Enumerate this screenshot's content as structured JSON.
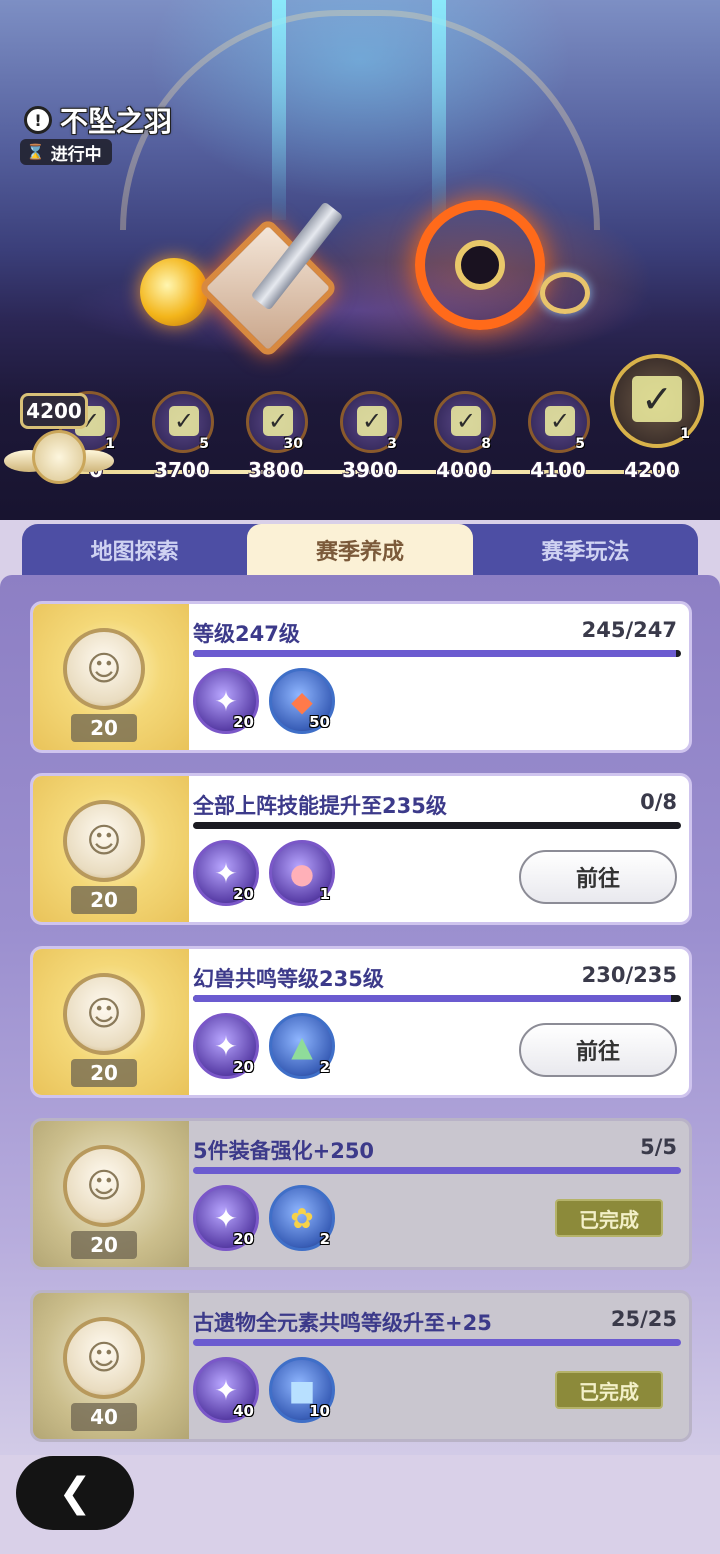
{
  "event": {
    "title": "不坠之羽",
    "status": "进行中",
    "current_points": "4200"
  },
  "milestones": [
    {
      "label": "0",
      "count": "1"
    },
    {
      "label": "3700",
      "count": "5"
    },
    {
      "label": "3800",
      "count": "30"
    },
    {
      "label": "3900",
      "count": "3"
    },
    {
      "label": "4000",
      "count": "8"
    },
    {
      "label": "4100",
      "count": "5"
    },
    {
      "label": "4200",
      "count": "1"
    }
  ],
  "tabs": [
    {
      "label": "地图探索"
    },
    {
      "label": "赛季养成"
    },
    {
      "label": "赛季玩法"
    }
  ],
  "active_tab": "赛季养成",
  "tasks": [
    {
      "title": "等级247级",
      "progress": "245/247",
      "progress_fraction": 0.99,
      "reward": "20",
      "items": [
        {
          "icon": "purple-orb-icon",
          "count": "20"
        },
        {
          "icon": "red-crystal-icon",
          "count": "50"
        }
      ],
      "action": "",
      "done": false
    },
    {
      "title": "全部上阵技能提升至235级",
      "progress": "0/8",
      "progress_fraction": 0,
      "reward": "20",
      "items": [
        {
          "icon": "purple-orb-icon",
          "count": "20"
        },
        {
          "icon": "peach-icon",
          "count": "1"
        }
      ],
      "action": "前往",
      "done": false
    },
    {
      "title": "幻兽共鸣等级235级",
      "progress": "230/235",
      "progress_fraction": 0.98,
      "reward": "20",
      "items": [
        {
          "icon": "purple-orb-icon",
          "count": "20"
        },
        {
          "icon": "forest-card-icon",
          "count": "2"
        }
      ],
      "action": "前往",
      "done": false
    },
    {
      "title": "5件装备强化+250",
      "progress": "5/5",
      "progress_fraction": 1,
      "reward": "20",
      "items": [
        {
          "icon": "purple-orb-icon",
          "count": "20"
        },
        {
          "icon": "flower-icon",
          "count": "2"
        }
      ],
      "action": "已完成",
      "done": true
    },
    {
      "title": "古遗物全元素共鸣等级升至+25",
      "progress": "25/25",
      "progress_fraction": 1,
      "reward": "40",
      "items": [
        {
          "icon": "purple-orb-icon",
          "count": "40"
        },
        {
          "icon": "blue-card-icon",
          "count": "10"
        }
      ],
      "action": "已完成",
      "done": true
    }
  ],
  "colors": {
    "tab_bar": "#4d4ea4",
    "tab_active": "#fbf1d6",
    "progress_fill": "#6b5bd0",
    "done_badge": "#8c8a3a"
  }
}
